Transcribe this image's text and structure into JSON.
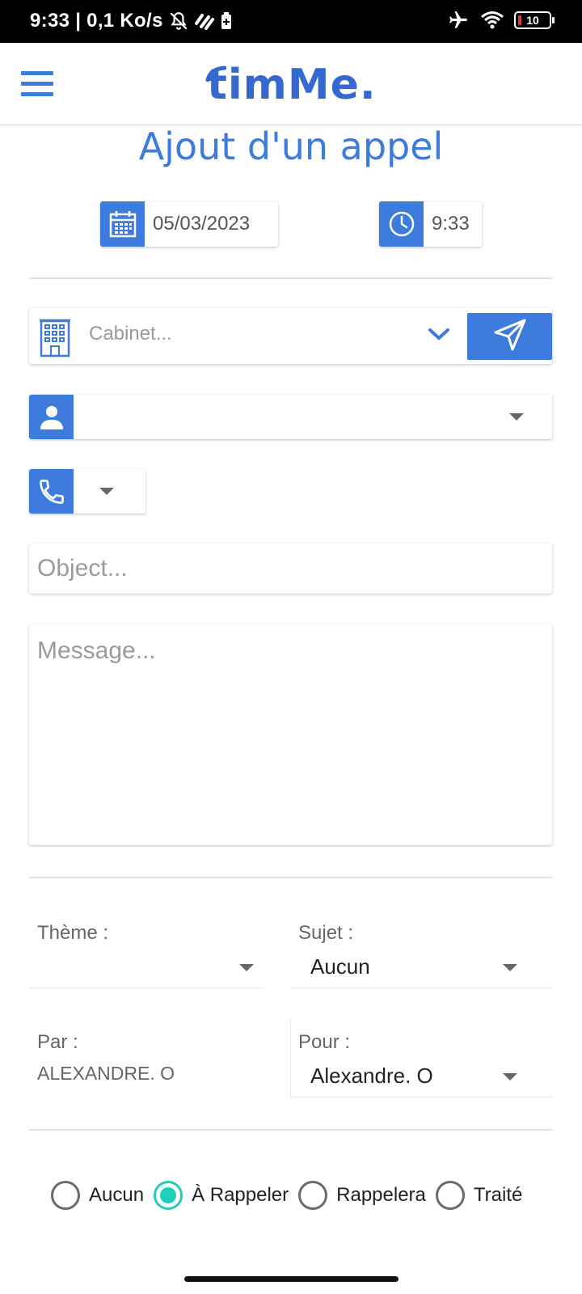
{
  "status_bar": {
    "time_speed": "9:33 | 0,1 Ko/s",
    "battery": "10",
    "icons": [
      "bell-off-icon",
      "data-saver-icon",
      "battery-saver-icon",
      "airplane-icon",
      "wifi-icon",
      "battery-icon"
    ]
  },
  "header": {
    "logo_text": "timMe.",
    "menu_icon": "menu-icon"
  },
  "page": {
    "title": "Ajout d'un appel"
  },
  "datetime": {
    "date": "05/03/2023",
    "time": "9:33"
  },
  "cabinet": {
    "placeholder": "Cabinet..."
  },
  "form": {
    "object_placeholder": "Object...",
    "message_placeholder": "Message..."
  },
  "details": {
    "theme_label": "Thème :",
    "theme_value": "",
    "sujet_label": "Sujet :",
    "sujet_value": "Aucun",
    "par_label": "Par :",
    "par_value": "ALEXANDRE. O",
    "pour_label": "Pour :",
    "pour_value": "Alexandre. O"
  },
  "status_options": [
    {
      "label": "Aucun",
      "checked": false
    },
    {
      "label": "À Rappeler",
      "checked": true
    },
    {
      "label": "Rappelera",
      "checked": false
    },
    {
      "label": "Traité",
      "checked": false
    }
  ],
  "colors": {
    "accent": "#3d7bdc",
    "radio_checked": "#1ecfbc"
  }
}
